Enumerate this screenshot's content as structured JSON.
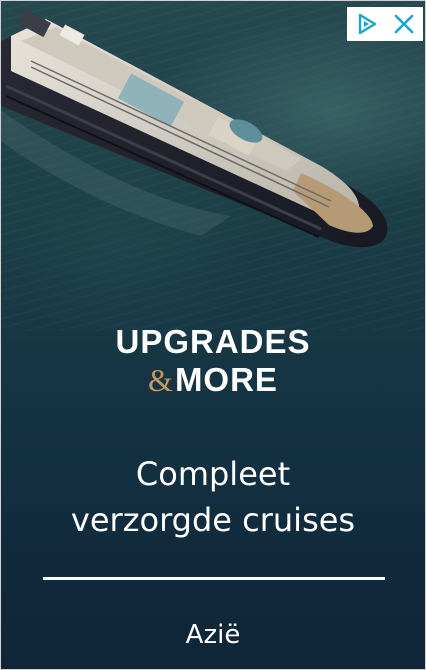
{
  "ad": {
    "brand": {
      "line1": "UPGRADES",
      "ampersand": "&",
      "line2": "MORE",
      "accent_color": "#c59a5e"
    },
    "headline_line1": "Compleet",
    "headline_line2": "verzorgde cruises",
    "destination": "Azië",
    "image": {
      "subject": "cruise ship at sea"
    },
    "controls": {
      "adchoices_icon": "adchoices-icon",
      "close_icon": "close-icon",
      "icon_color": "#1aa6c9"
    }
  }
}
